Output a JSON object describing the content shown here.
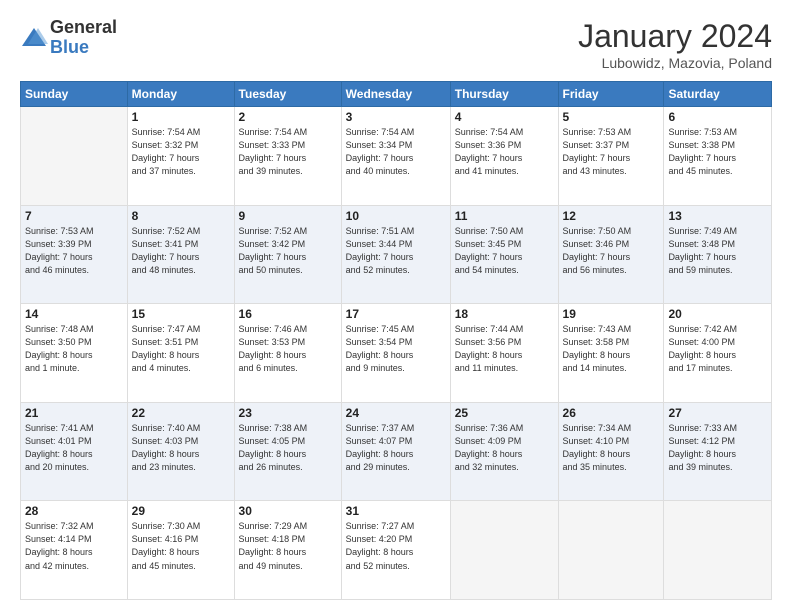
{
  "header": {
    "logo_general": "General",
    "logo_blue": "Blue",
    "title": "January 2024",
    "location": "Lubowidz, Mazovia, Poland"
  },
  "weekdays": [
    "Sunday",
    "Monday",
    "Tuesday",
    "Wednesday",
    "Thursday",
    "Friday",
    "Saturday"
  ],
  "weeks": [
    [
      {
        "day": "",
        "info": ""
      },
      {
        "day": "1",
        "info": "Sunrise: 7:54 AM\nSunset: 3:32 PM\nDaylight: 7 hours\nand 37 minutes."
      },
      {
        "day": "2",
        "info": "Sunrise: 7:54 AM\nSunset: 3:33 PM\nDaylight: 7 hours\nand 39 minutes."
      },
      {
        "day": "3",
        "info": "Sunrise: 7:54 AM\nSunset: 3:34 PM\nDaylight: 7 hours\nand 40 minutes."
      },
      {
        "day": "4",
        "info": "Sunrise: 7:54 AM\nSunset: 3:36 PM\nDaylight: 7 hours\nand 41 minutes."
      },
      {
        "day": "5",
        "info": "Sunrise: 7:53 AM\nSunset: 3:37 PM\nDaylight: 7 hours\nand 43 minutes."
      },
      {
        "day": "6",
        "info": "Sunrise: 7:53 AM\nSunset: 3:38 PM\nDaylight: 7 hours\nand 45 minutes."
      }
    ],
    [
      {
        "day": "7",
        "info": "Sunrise: 7:53 AM\nSunset: 3:39 PM\nDaylight: 7 hours\nand 46 minutes."
      },
      {
        "day": "8",
        "info": "Sunrise: 7:52 AM\nSunset: 3:41 PM\nDaylight: 7 hours\nand 48 minutes."
      },
      {
        "day": "9",
        "info": "Sunrise: 7:52 AM\nSunset: 3:42 PM\nDaylight: 7 hours\nand 50 minutes."
      },
      {
        "day": "10",
        "info": "Sunrise: 7:51 AM\nSunset: 3:44 PM\nDaylight: 7 hours\nand 52 minutes."
      },
      {
        "day": "11",
        "info": "Sunrise: 7:50 AM\nSunset: 3:45 PM\nDaylight: 7 hours\nand 54 minutes."
      },
      {
        "day": "12",
        "info": "Sunrise: 7:50 AM\nSunset: 3:46 PM\nDaylight: 7 hours\nand 56 minutes."
      },
      {
        "day": "13",
        "info": "Sunrise: 7:49 AM\nSunset: 3:48 PM\nDaylight: 7 hours\nand 59 minutes."
      }
    ],
    [
      {
        "day": "14",
        "info": "Sunrise: 7:48 AM\nSunset: 3:50 PM\nDaylight: 8 hours\nand 1 minute."
      },
      {
        "day": "15",
        "info": "Sunrise: 7:47 AM\nSunset: 3:51 PM\nDaylight: 8 hours\nand 4 minutes."
      },
      {
        "day": "16",
        "info": "Sunrise: 7:46 AM\nSunset: 3:53 PM\nDaylight: 8 hours\nand 6 minutes."
      },
      {
        "day": "17",
        "info": "Sunrise: 7:45 AM\nSunset: 3:54 PM\nDaylight: 8 hours\nand 9 minutes."
      },
      {
        "day": "18",
        "info": "Sunrise: 7:44 AM\nSunset: 3:56 PM\nDaylight: 8 hours\nand 11 minutes."
      },
      {
        "day": "19",
        "info": "Sunrise: 7:43 AM\nSunset: 3:58 PM\nDaylight: 8 hours\nand 14 minutes."
      },
      {
        "day": "20",
        "info": "Sunrise: 7:42 AM\nSunset: 4:00 PM\nDaylight: 8 hours\nand 17 minutes."
      }
    ],
    [
      {
        "day": "21",
        "info": "Sunrise: 7:41 AM\nSunset: 4:01 PM\nDaylight: 8 hours\nand 20 minutes."
      },
      {
        "day": "22",
        "info": "Sunrise: 7:40 AM\nSunset: 4:03 PM\nDaylight: 8 hours\nand 23 minutes."
      },
      {
        "day": "23",
        "info": "Sunrise: 7:38 AM\nSunset: 4:05 PM\nDaylight: 8 hours\nand 26 minutes."
      },
      {
        "day": "24",
        "info": "Sunrise: 7:37 AM\nSunset: 4:07 PM\nDaylight: 8 hours\nand 29 minutes."
      },
      {
        "day": "25",
        "info": "Sunrise: 7:36 AM\nSunset: 4:09 PM\nDaylight: 8 hours\nand 32 minutes."
      },
      {
        "day": "26",
        "info": "Sunrise: 7:34 AM\nSunset: 4:10 PM\nDaylight: 8 hours\nand 35 minutes."
      },
      {
        "day": "27",
        "info": "Sunrise: 7:33 AM\nSunset: 4:12 PM\nDaylight: 8 hours\nand 39 minutes."
      }
    ],
    [
      {
        "day": "28",
        "info": "Sunrise: 7:32 AM\nSunset: 4:14 PM\nDaylight: 8 hours\nand 42 minutes."
      },
      {
        "day": "29",
        "info": "Sunrise: 7:30 AM\nSunset: 4:16 PM\nDaylight: 8 hours\nand 45 minutes."
      },
      {
        "day": "30",
        "info": "Sunrise: 7:29 AM\nSunset: 4:18 PM\nDaylight: 8 hours\nand 49 minutes."
      },
      {
        "day": "31",
        "info": "Sunrise: 7:27 AM\nSunset: 4:20 PM\nDaylight: 8 hours\nand 52 minutes."
      },
      {
        "day": "",
        "info": ""
      },
      {
        "day": "",
        "info": ""
      },
      {
        "day": "",
        "info": ""
      }
    ]
  ]
}
